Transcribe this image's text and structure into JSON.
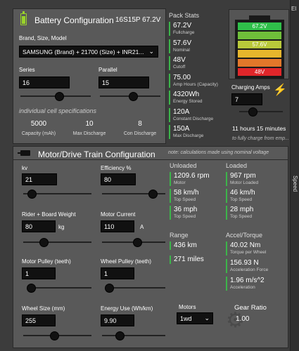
{
  "battery": {
    "title": "Battery Configuration",
    "config_code": "16S15P 67.2V",
    "model_label": "Brand, Size, Model",
    "model_value": "SAMSUNG (Brand) + 21700 (Size) + INR21...",
    "series_label": "Series",
    "series_value": "16",
    "series_slider": 0.55,
    "parallel_label": "Parallel",
    "parallel_value": "15",
    "parallel_slider": 0.55,
    "cell_spec_title": "individual cell specifications",
    "capacity_value": "5000",
    "capacity_label": "Capacity (mAh)",
    "max_discharge_value": "10",
    "max_discharge_label": "Max Discharge",
    "con_discharge_value": "8",
    "con_discharge_label": "Con Discharge"
  },
  "pack_stats": {
    "title": "Pack Stats",
    "items": [
      {
        "value": "67.2V",
        "caption": "Fullcharge"
      },
      {
        "value": "57.6V",
        "caption": "Nominal"
      },
      {
        "value": "48V",
        "caption": "Cutoff"
      },
      {
        "value": "75.00",
        "caption": "Amp Hours (Capacity)"
      },
      {
        "value": "4320Wh",
        "caption": "Energy Stored"
      },
      {
        "value": "120A",
        "caption": "Constant Discharge"
      },
      {
        "value": "150A",
        "caption": "Max Discharge"
      }
    ],
    "battery_levels": [
      "67.2V",
      "",
      "57.6V",
      "",
      "",
      "48V"
    ],
    "battery_colors": [
      "#2fbf4a",
      "#6fbf3a",
      "#b9c93a",
      "#e6b52c",
      "#e2772a",
      "#e0262a"
    ],
    "charging_label": "Charging Amps",
    "charging_value": "7",
    "charging_slider": 0.3,
    "charge_time": "11 hours 15 minutes",
    "charge_note": "to fully charge from emp..."
  },
  "motor": {
    "title": "Motor/Drive Train Configuration",
    "note": "note: calculations made using nominal voltage",
    "kv_label": "kv",
    "kv_value": "21",
    "kv_slider": 0.12,
    "efficiency_label": "Efficiency %",
    "efficiency_value": "80",
    "efficiency_slider": 0.8,
    "weight_label": "Rider + Board Weight",
    "weight_value": "80",
    "weight_unit": "kg",
    "weight_slider": 0.3,
    "current_label": "Motor Current",
    "current_value": "110",
    "current_unit": "A",
    "current_slider": 0.55,
    "motor_pulley_label": "Motor Pulley (teeth)",
    "motor_pulley_value": "1",
    "motor_pulley_slider": 0.05,
    "wheel_pulley_label": "Wheel Pulley (teeth)",
    "wheel_pulley_value": "1",
    "wheel_pulley_slider": 0.05,
    "wheel_size_label": "Wheel Size (mm)",
    "wheel_size_value": "255",
    "wheel_size_slider": 0.45,
    "energy_use_label": "Energy Use (Wh/km)",
    "energy_use_value": "9.90",
    "energy_use_slider": 0.28,
    "motors_label": "Motors",
    "motors_value": "1wd",
    "gear_ratio_label": "Gear Ratio",
    "gear_ratio_value": "1.00"
  },
  "results": {
    "unloaded_title": "Unloaded",
    "unloaded": [
      {
        "value": "1209.6 rpm",
        "caption": "Motor"
      },
      {
        "value": "58 km/h",
        "caption": "Top Speed"
      },
      {
        "value": "36 mph",
        "caption": "Top Speed"
      }
    ],
    "loaded_title": "Loaded",
    "loaded": [
      {
        "value": "967 rpm",
        "caption": "Motor Loaded"
      },
      {
        "value": "46 km/h",
        "caption": "Top Speed"
      },
      {
        "value": "28 mph",
        "caption": "Top Speed"
      }
    ],
    "range_title": "Range",
    "range": [
      {
        "value": "436 km",
        "caption": ""
      },
      {
        "value": "271 miles",
        "caption": ""
      }
    ],
    "accel_title": "Accel/Torque",
    "accel": [
      {
        "value": "40.02 Nm",
        "caption": "Torque per Wheel"
      },
      {
        "value": "156.93 N",
        "caption": "Acceleration Force"
      },
      {
        "value": "1.96 m/s^2",
        "caption": "Acceleration"
      }
    ]
  },
  "side": {
    "top_label": "El",
    "speed_label": "Speed"
  }
}
